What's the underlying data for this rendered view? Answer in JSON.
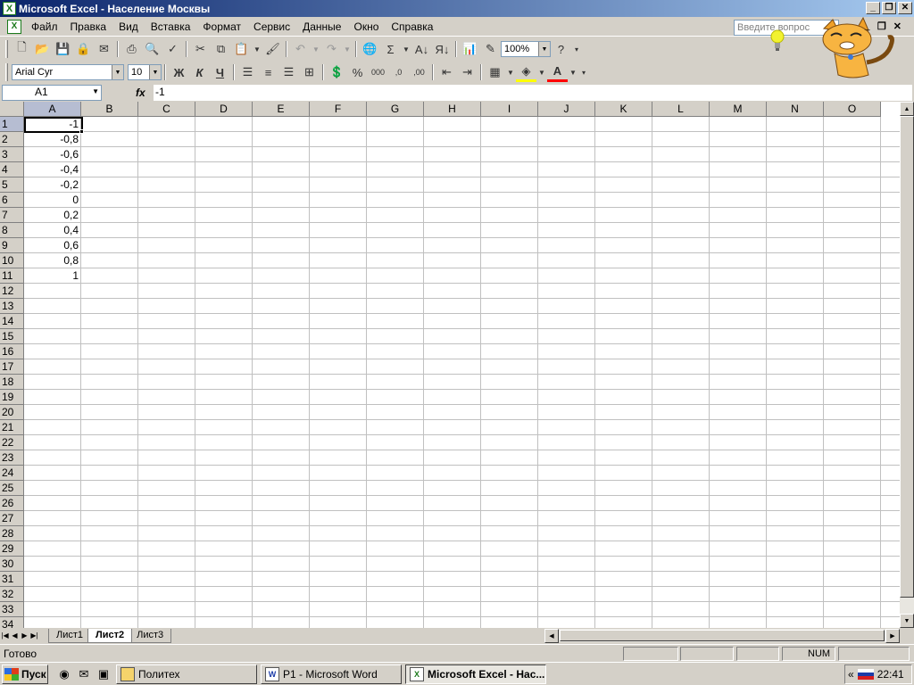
{
  "window": {
    "title": "Microsoft Excel - Население Москвы"
  },
  "menu": {
    "items": [
      "Файл",
      "Правка",
      "Вид",
      "Вставка",
      "Формат",
      "Сервис",
      "Данные",
      "Окно",
      "Справка"
    ],
    "help_placeholder": "Введите вопрос"
  },
  "toolbar": {
    "zoom": "100%",
    "font_name": "Arial Cyr",
    "font_size": "10",
    "bold_label": "Ж",
    "italic_label": "К",
    "underline_label": "Ч",
    "percent_label": "%",
    "thousands_label": "000",
    "inc_decimal_label": ",0",
    "dec_decimal_label": ",00"
  },
  "formula_bar": {
    "name_box": "A1",
    "fx_label": "fx",
    "value": "-1"
  },
  "grid": {
    "columns": [
      "A",
      "B",
      "C",
      "D",
      "E",
      "F",
      "G",
      "H",
      "I",
      "J",
      "K",
      "L",
      "M",
      "N",
      "O"
    ],
    "row_count": 34,
    "selected_cell": "A1",
    "column_a_values": [
      "-1",
      "-0,8",
      "-0,6",
      "-0,4",
      "-0,2",
      "0",
      "0,2",
      "0,4",
      "0,6",
      "0,8",
      "1"
    ]
  },
  "sheets": {
    "tabs": [
      "Лист1",
      "Лист2",
      "Лист3"
    ],
    "active": "Лист2"
  },
  "status": {
    "ready": "Готово",
    "num": "NUM"
  },
  "taskbar": {
    "start": "Пуск",
    "windows": [
      "Политех",
      "P1 - Microsoft Word",
      "Microsoft Excel - Нас..."
    ],
    "tray_chevron": "«",
    "clock": "22:41"
  },
  "colors": {
    "title_start": "#0a246a",
    "title_end": "#a6caf0",
    "selection_header": "#b6bdd2",
    "excel_green": "#1c7a1c"
  }
}
